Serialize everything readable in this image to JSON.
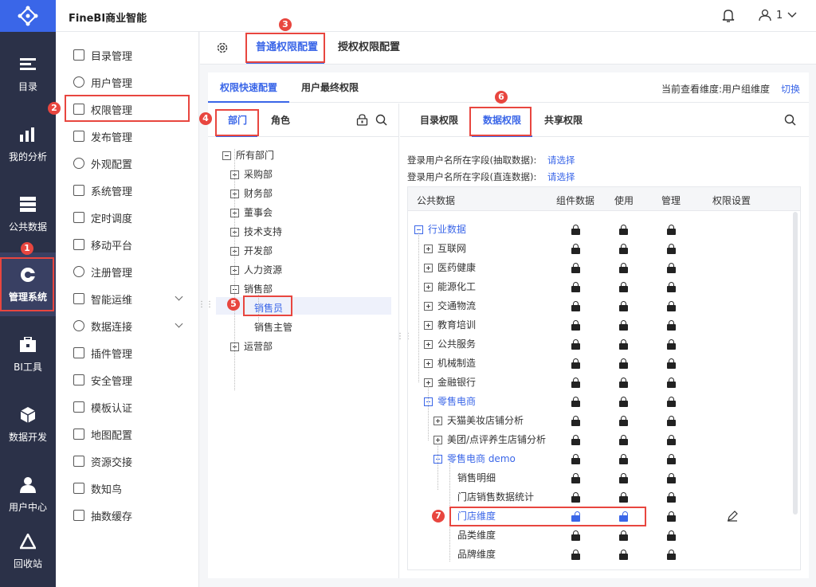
{
  "app": {
    "title": "FineBI商业智能",
    "user": "1"
  },
  "rail": [
    {
      "label": "目录",
      "icon": "catalog-icon"
    },
    {
      "label": "我的分析",
      "icon": "analysis-icon"
    },
    {
      "label": "公共数据",
      "icon": "public-data-icon"
    },
    {
      "label": "管理系统",
      "icon": "management-icon"
    },
    {
      "label": "BI工具",
      "icon": "toolbox-icon"
    },
    {
      "label": "数据开发",
      "icon": "data-dev-icon"
    },
    {
      "label": "用户中心",
      "icon": "user-center-icon"
    },
    {
      "label": "回收站",
      "icon": "recycle-icon"
    }
  ],
  "sidebar": [
    "目录管理",
    "用户管理",
    "权限管理",
    "发布管理",
    "外观配置",
    "系统管理",
    "定时调度",
    "移动平台",
    "注册管理",
    "智能运维",
    "数据连接",
    "插件管理",
    "安全管理",
    "模板认证",
    "地图配置",
    "资源交接",
    "数知鸟",
    "抽数缓存"
  ],
  "top_tabs": [
    "普通权限配置",
    "授权权限配置"
  ],
  "sub_tabs": [
    "权限快速配置",
    "用户最终权限"
  ],
  "view_dimension": "当前查看维度:用户组维度",
  "switch_link": "切换",
  "left_tabs": [
    "部门",
    "角色"
  ],
  "dept_tree": [
    "所有部门",
    "采购部",
    "财务部",
    "董事会",
    "技术支持",
    "开发部",
    "人力资源",
    "销售部",
    "销售员",
    "销售主管",
    "运营部"
  ],
  "right_tabs": [
    "目录权限",
    "数据权限",
    "共享权限"
  ],
  "login_field_extract": {
    "label": "登录用户名所在字段(抽取数据):",
    "link": "请选择"
  },
  "login_field_direct": {
    "label": "登录用户名所在字段(直连数据):",
    "link": "请选择"
  },
  "table_headers": [
    "公共数据",
    "组件数据",
    "使用",
    "管理",
    "权限设置"
  ],
  "data_tree": [
    "行业数据",
    "互联网",
    "医药健康",
    "能源化工",
    "交通物流",
    "教育培训",
    "公共服务",
    "机械制造",
    "金融银行",
    "零售电商",
    "天猫美妆店铺分析",
    "美团/点评养生店铺分析",
    "零售电商 demo",
    "销售明细",
    "门店销售数据统计",
    "门店维度",
    "品类维度",
    "品牌维度"
  ],
  "badges": [
    "1",
    "2",
    "3",
    "4",
    "5",
    "6",
    "7"
  ],
  "colors": {
    "accent": "#3a66e8",
    "highlight": "#e8463f",
    "rail": "#2b3148"
  }
}
